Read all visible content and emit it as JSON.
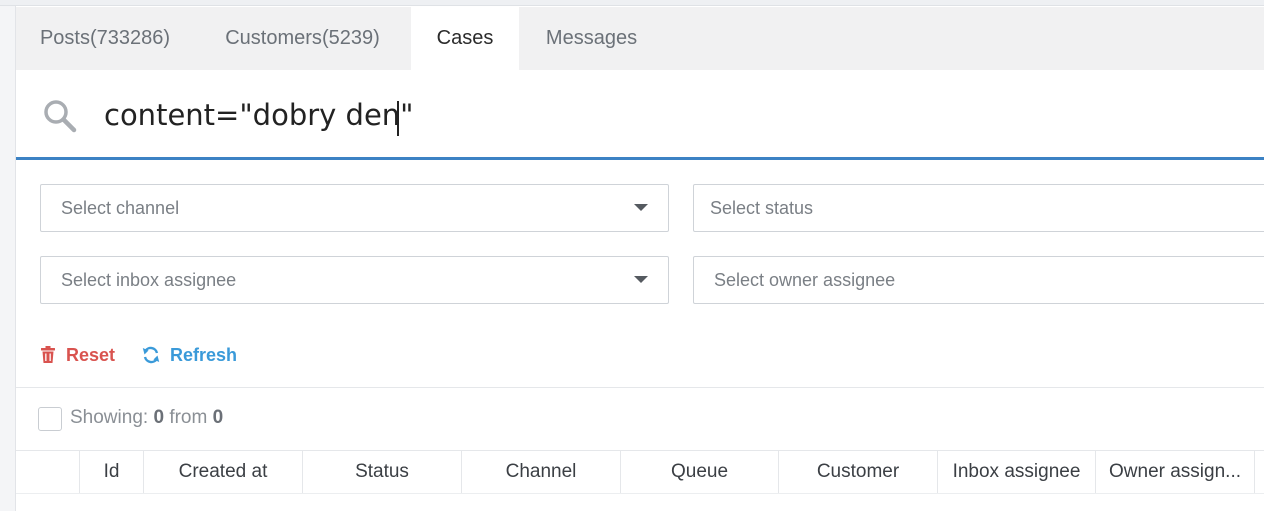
{
  "tabs": [
    {
      "name": "Posts",
      "count": "(733286)"
    },
    {
      "name": "Customers",
      "count": "(5239)"
    },
    {
      "name": "Cases",
      "count": ""
    },
    {
      "name": "Messages",
      "count": ""
    }
  ],
  "active_tab": "Cases",
  "search": {
    "value": "content=\"dobry den\"",
    "icon": "search-icon"
  },
  "filters": {
    "channel_placeholder": "Select channel",
    "status_placeholder": "Select status",
    "inbox_assignee_placeholder": "Select inbox assignee",
    "owner_assignee_placeholder": "Select owner assignee"
  },
  "actions": {
    "reset_label": "Reset",
    "refresh_label": "Refresh"
  },
  "showing": {
    "label": "Showing:",
    "shown": "0",
    "from_label": "from",
    "total": "0"
  },
  "table": {
    "columns": [
      "Id",
      "Created at",
      "Status",
      "Channel",
      "Queue",
      "Customer",
      "Inbox assignee",
      "Owner assign..."
    ]
  },
  "colors": {
    "accent": "#3c82c4",
    "reset": "#d9534f",
    "refresh": "#3a9ad9"
  }
}
